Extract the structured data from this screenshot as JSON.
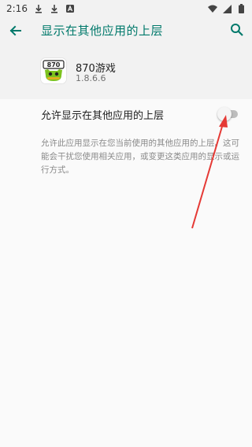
{
  "status_bar": {
    "time": "2:16",
    "icons": [
      "download-icon",
      "download-icon",
      "notification-a-icon",
      "wifi-icon",
      "signal-icon",
      "battery-icon"
    ]
  },
  "app_bar": {
    "title": "显示在其他应用的上层",
    "back_icon": "back-arrow-icon",
    "search_icon": "search-icon"
  },
  "app_info": {
    "name": "870游戏",
    "version": "1.8.6.6",
    "icon_text": "870"
  },
  "permission": {
    "label": "允许显示在其他应用的上层",
    "enabled": false,
    "description": "允许此应用显示在您当前使用的其他应用的上层。这可能会干扰您使用相关应用，或变更这类应用的显示或运行方式。"
  },
  "colors": {
    "accent": "#00796b",
    "annotation": "#e53935"
  }
}
